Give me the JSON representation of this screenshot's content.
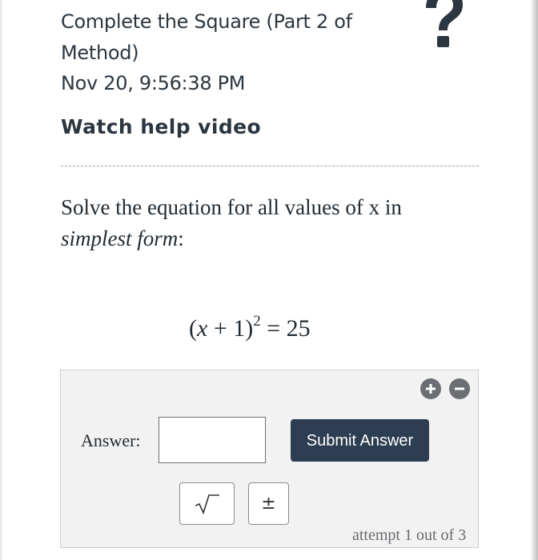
{
  "header": {
    "title": "Complete the Square (Part 2 of Method)",
    "timestamp": "Nov 20, 9:56:38 PM",
    "help_link": "Watch help video",
    "help_icon": "question-mark-icon"
  },
  "question": {
    "prompt": "Solve the equation for all values of x in",
    "prompt_emphasis": "simplest form",
    "prompt_suffix": ":",
    "equation": {
      "lhs_open": "(",
      "variable": "x",
      "plus": " + 1)",
      "exponent": "2",
      "equals": " = ",
      "rhs": "25"
    }
  },
  "answer": {
    "label": "Answer:",
    "input_value": "",
    "submit_label": "Submit Answer",
    "zoom_in_icon": "plus-circle-icon",
    "zoom_out_icon": "minus-circle-icon",
    "tools": {
      "sqrt_icon": "square-root-icon",
      "plus_minus": "±"
    },
    "attempt_text": "attempt 1 out of 3"
  },
  "colors": {
    "text": "#2b3640",
    "button": "#2e3e52",
    "panel": "#f2f2f2",
    "zoom": "#6b6e72"
  }
}
